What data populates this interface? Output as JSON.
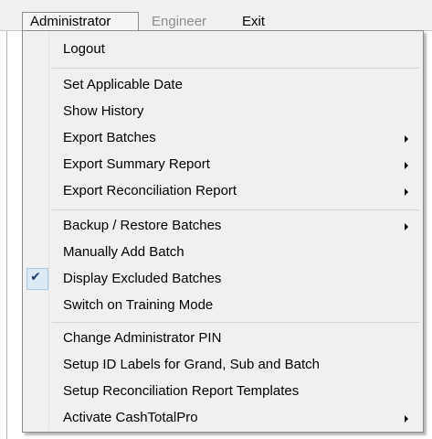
{
  "menubar": {
    "items": [
      {
        "label": "Administrator",
        "state": "open"
      },
      {
        "label": "Engineer",
        "state": "disabled"
      },
      {
        "label": "Exit",
        "state": "normal"
      }
    ]
  },
  "dropdown": {
    "items": [
      {
        "label": "Logout"
      },
      {
        "label": "Set Applicable Date"
      },
      {
        "label": "Show History"
      },
      {
        "label": "Export Batches",
        "submenu": true,
        "icon": "chevron-right-icon"
      },
      {
        "label": "Export Summary Report",
        "submenu": true,
        "icon": "chevron-right-icon"
      },
      {
        "label": "Export Reconciliation Report",
        "submenu": true,
        "icon": "chevron-right-icon"
      },
      {
        "label": "Backup / Restore Batches",
        "submenu": true,
        "icon": "chevron-right-icon"
      },
      {
        "label": "Manually Add Batch"
      },
      {
        "label": "Display Excluded Batches",
        "checked": true,
        "icon": "checkmark-icon"
      },
      {
        "label": "Switch on Training Mode"
      },
      {
        "label": "Change Administrator PIN"
      },
      {
        "label": "Setup ID Labels for Grand, Sub and Batch"
      },
      {
        "label": "Setup Reconciliation Report Templates"
      },
      {
        "label": "Activate CashTotalPro",
        "submenu": true,
        "icon": "chevron-right-icon"
      }
    ]
  },
  "colors": {
    "menu_background": "#f0f0f0",
    "menu_border": "#8c8c8c",
    "disabled_text": "#8d8d8d",
    "check_highlight": "#dceaf6"
  }
}
